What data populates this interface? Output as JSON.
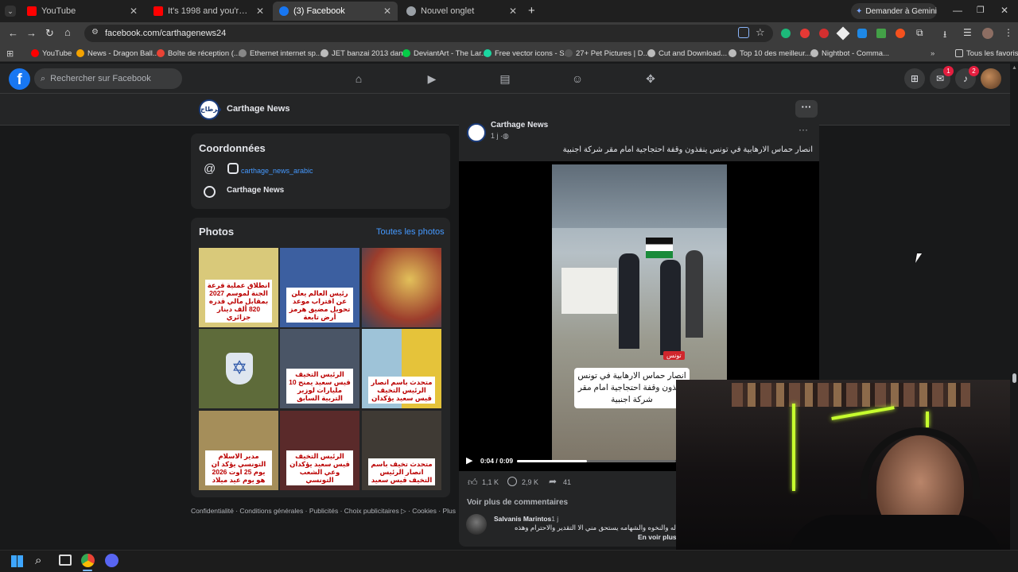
{
  "browser": {
    "tabs": [
      {
        "title": "YouTube",
        "fav_color": "#ff0000",
        "active": false
      },
      {
        "title": "It's 1998 and you're drifting in Tokyo",
        "fav_color": "#ff0000",
        "active": false
      },
      {
        "title": "(3) Facebook",
        "fav_color": "#1877f2",
        "active": true
      },
      {
        "title": "Nouvel onglet",
        "fav_color": "#9aa0a6",
        "active": false
      }
    ],
    "new_tab_icon": "plus-icon",
    "gemini_button": "Demander à Gemini",
    "url": "facebook.com/carthagenews24",
    "bookmarks": [
      {
        "label": "YouTube",
        "color": "#ff0000"
      },
      {
        "label": "News - Dragon Ball...",
        "color": "#f4a300"
      },
      {
        "label": "Boîte de réception (...",
        "color": "#ea4335"
      },
      {
        "label": "Ethernet internet sp...",
        "color": "#888888"
      },
      {
        "label": "JET banzai 2013 dan...",
        "color": "#bbbbbb"
      },
      {
        "label": "DeviantArt - The Lar...",
        "color": "#05cc47"
      },
      {
        "label": "Free vector icons - S...",
        "color": "#1bd7a1"
      },
      {
        "label": "27+ Pet Pictures | D...",
        "color": "#555555"
      },
      {
        "label": "Cut and Download...",
        "color": "#bbbbbb"
      },
      {
        "label": "Top 10 des meilleur...",
        "color": "#bbbbbb"
      },
      {
        "label": "Nightbot - Comma...",
        "color": "#bbbbbb"
      }
    ],
    "all_favorites": "Tous les favoris"
  },
  "facebook": {
    "search_placeholder": "Rechercher sur Facebook",
    "messenger_badge": "1",
    "notif_badge": "2",
    "page_name": "Carthage News",
    "more": "···"
  },
  "sidebar": {
    "contact_title": "Coordonnées",
    "instagram": "carthage_news_arabic",
    "messenger_name": "Carthage News",
    "photos_title": "Photos",
    "all_photos": "Toutes les photos",
    "photos": [
      {
        "caption": "انطلاق عملية قرعة الجنة لموسم 2027 بمقابل مالي قدره 820 ألف دينار جزائري",
        "bg": "#d9c97a"
      },
      {
        "caption": "رئيس العالم يعلن عن اقتراب موعد تحويل مضيق هرمز أرض تابعة",
        "bg": "#3c5fa0"
      },
      {
        "caption": "",
        "bg": "#9c3d2c"
      },
      {
        "caption": "",
        "bg": "#5e6b3a"
      },
      {
        "caption": "الرئيس التخيف قيس سعيد يمنح 10 مليارات لوزير التربية السابق",
        "bg": "#4a5566"
      },
      {
        "caption": "متحدث باسم انصار الرئيس التخيف قيس سعيد يؤكدان",
        "bg": "#c2c8a0"
      },
      {
        "caption": "مدير الاسلام التونسي يؤكد ان يوم 25 اوت 2026 هو يوم عيد ميلاد",
        "bg": "#a58e5a"
      },
      {
        "caption": "الرئيس التخيف قيس سعيد يؤكدان وعي الشعب التونسي",
        "bg": "#5a2a2a"
      },
      {
        "caption": "متحدث تخيف باسم انصار الرئيس التخيف قيس سعيد",
        "bg": "#3f3a34"
      }
    ],
    "footer": "Confidentialité · Conditions générales · Publicités · Choix publicitaires ▷ · Cookies · Plus"
  },
  "post": {
    "author": "Carthage News",
    "time": "1 j · ",
    "text": "انصار حماس الارهابية في تونس ينفذون وقفة احتجاجية امام مقر شركة اجنبية",
    "video_caption": "انصار حماس الارهابية في تونس ينفذون وقفة احتجاجية امام مقر شركة اجنبية",
    "video_tag": "تونس",
    "video_time": "0:04 / 0:09",
    "video_progress": 0.44,
    "reactions": "1,1 K",
    "comments": "2,9 K",
    "shares": "41",
    "see_more_comments": "Voir plus de commentaires",
    "comment_author": "Salvanis Marintos",
    "comment_time": "· 1 j",
    "comment_text": "له والنخوه والشهامه يستحق مني الا التقدير والاحترام وهذه",
    "see_more": "En voir plus"
  }
}
